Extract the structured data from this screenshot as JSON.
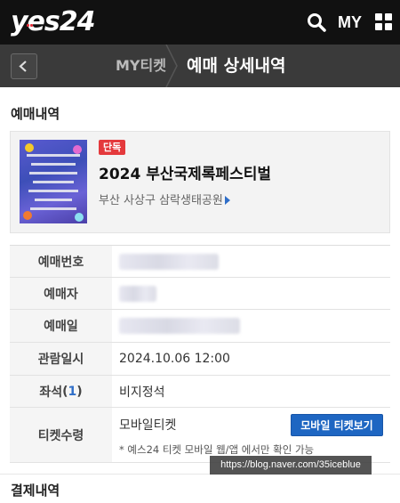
{
  "header": {
    "logo": "yes24",
    "my_label": "MY"
  },
  "subheader": {
    "previous": "MY티켓",
    "current": "예매 상세내역"
  },
  "reservation": {
    "section_title": "예매내역",
    "badge": "단독",
    "title": "2024 부산국제록페스티벌",
    "venue": "부산 사상구 삼락생태공원"
  },
  "details": {
    "booking_number_label": "예매번호",
    "booker_label": "예매자",
    "booking_date_label": "예매일",
    "viewing_label": "관람일시",
    "viewing_value": "2024.10.06 12:00",
    "seat_label": "좌석",
    "seat_count": "1",
    "seat_value": "비지정석",
    "ticket_label": "티켓수령",
    "ticket_value": "모바일티켓",
    "mobile_ticket_button": "모바일 티켓보기",
    "ticket_note": "* 예스24 티켓 모바일 웹/앱 에서만 확인 가능"
  },
  "payment": {
    "section_title": "결제내역"
  },
  "watermark": "https://blog.naver.com/35iceblue",
  "colors": {
    "topbar": "#111111",
    "subheader": "#3a3a3a",
    "badge": "#e4393c",
    "button": "#1e66c2",
    "link": "#2f6ec8"
  }
}
